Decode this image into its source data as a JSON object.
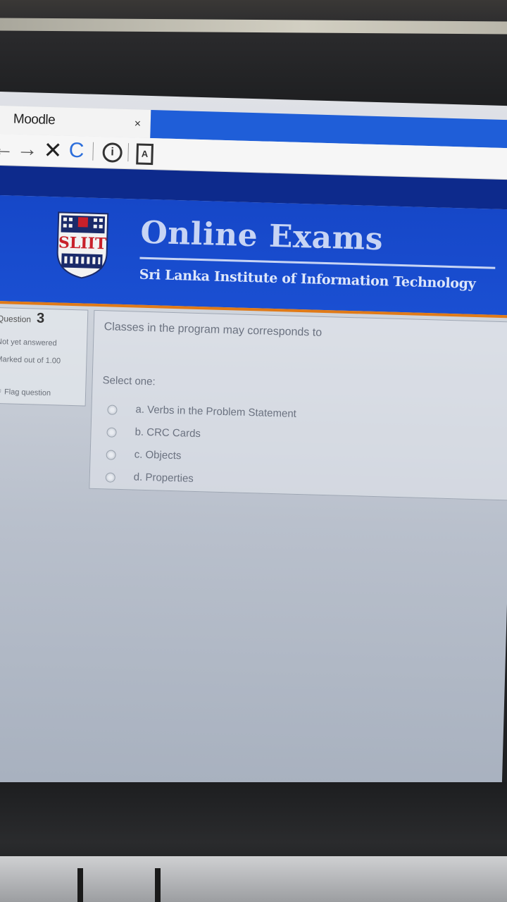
{
  "browser": {
    "tab_title": "Moodle",
    "tab_close": "×",
    "nav": {
      "back_icon": "arrow-left-icon",
      "forward_icon": "arrow-right-icon",
      "stop_icon": "close-icon",
      "reload_icon": "reload-icon",
      "info_icon": "info-icon",
      "page_icon": "page-icon"
    }
  },
  "header": {
    "logo_text": "SLIIT",
    "title": "Online Exams",
    "subtitle": "Sri Lanka Institute of Information Technology"
  },
  "question_info": {
    "label": "Question",
    "number": "3",
    "state": "Not yet answered",
    "mark": "Marked out of 1.00",
    "flag_label": "Flag question"
  },
  "question": {
    "text": "Classes in the program may corresponds to",
    "prompt": "Select one:",
    "options": [
      {
        "label": "a. Verbs in the Problem Statement",
        "selected": false
      },
      {
        "label": "b. CRC Cards",
        "selected": false
      },
      {
        "label": "c. Objects",
        "selected": false
      },
      {
        "label": "d. Properties",
        "selected": false
      }
    ]
  },
  "colors": {
    "header_blue": "#1a4fd2",
    "dark_band": "#0d2a8c",
    "accent_orange": "#e07a18"
  }
}
